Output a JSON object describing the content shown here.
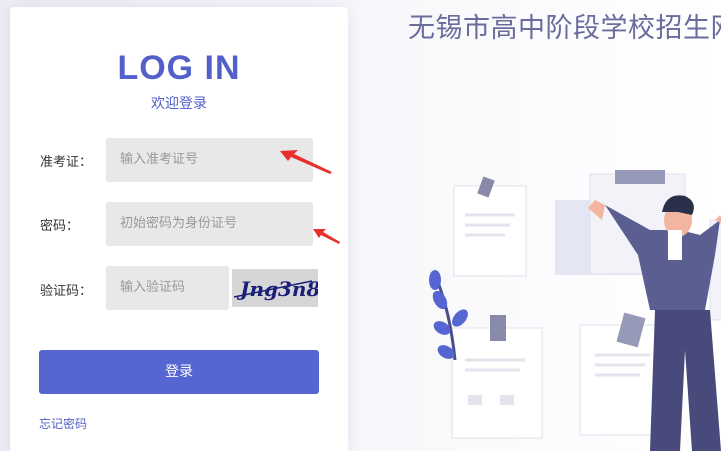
{
  "header": {
    "site_title": "无锡市高中阶段学校招生网"
  },
  "login": {
    "title": "LOG IN",
    "subtitle": "欢迎登录",
    "exam_id_label": "准考证：",
    "exam_id_placeholder": "输入准考证号",
    "password_label": "密码：",
    "password_placeholder": "初始密码为身份证号",
    "captcha_label": "验证码：",
    "captcha_placeholder": "输入验证码",
    "captcha_text": "Jng3n8",
    "submit_label": "登录",
    "forgot_label": "忘记密码"
  },
  "colors": {
    "accent": "#5565d2",
    "arrow": "#e8302a",
    "title": "#6a6c9c"
  }
}
